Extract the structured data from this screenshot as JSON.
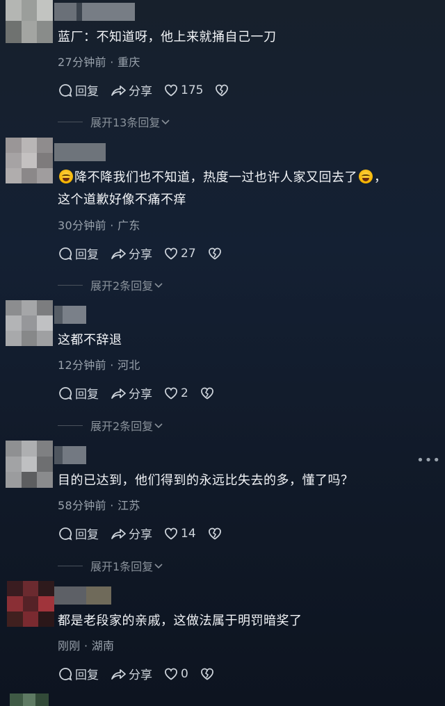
{
  "comments": [
    {
      "text": "蓝厂：不知道呀，他上来就捅自己一刀",
      "time_location": "27分钟前 · 重庆",
      "reply_label": "回复",
      "share_label": "分享",
      "likes": "175",
      "expand_replies": "展开13条回复"
    },
    {
      "text_part1": "降不降我们也不知道，热度一过也许人家又回去了",
      "text_part2": "，",
      "text_line2": "这个道歉好像不痛不痒",
      "time_location": "30分钟前 · 广东",
      "reply_label": "回复",
      "share_label": "分享",
      "likes": "27",
      "expand_replies": "展开2条回复"
    },
    {
      "text": "这都不辞退",
      "time_location": "12分钟前 · 河北",
      "reply_label": "回复",
      "share_label": "分享",
      "likes": "2",
      "expand_replies": "展开2条回复"
    },
    {
      "text": "目的已达到，他们得到的永远比失去的多，懂了吗？",
      "time_location": "58分钟前 · 江苏",
      "reply_label": "回复",
      "share_label": "分享",
      "likes": "14",
      "expand_replies": "展开1条回复"
    },
    {
      "text": "都是老段家的亲戚，这做法属于明罚暗奖了",
      "time_location": "刚刚 · 湖南",
      "reply_label": "回复",
      "share_label": "分享",
      "likes": "0"
    }
  ],
  "icons": {
    "reply": "chat-bubble-icon",
    "share": "share-arrow-icon",
    "like": "heart-icon",
    "dislike": "broken-heart-icon",
    "expand": "chevron-down-icon",
    "more": "more-dots-icon",
    "emoji": "laughing-tears-emoji"
  },
  "colors": {
    "text": "#f2f4f7",
    "meta": "#9aa3ad",
    "action": "#cfd5dc"
  }
}
